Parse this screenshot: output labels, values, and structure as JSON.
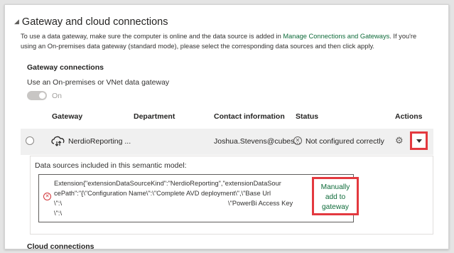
{
  "section": {
    "title": "Gateway and cloud connections",
    "description_part1": "To use a data gateway, make sure the computer is online and the data source is added in ",
    "manage_link": "Manage Connections and Gateways",
    "description_part2": ". If you're using an On-premises data gateway (standard mode), please select the corresponding data sources and then click apply."
  },
  "gateway_connections": {
    "title": "Gateway connections",
    "use_gateway_label": "Use an On-premises or VNet data gateway",
    "toggle_label": "On",
    "columns": {
      "gateway": "Gateway",
      "department": "Department",
      "contact": "Contact information",
      "status": "Status",
      "actions": "Actions"
    },
    "row": {
      "gateway_name": "NerdioReporting ...",
      "contact": "Joshua.Stevens@cubes...",
      "status": "Not configured correctly"
    }
  },
  "data_sources": {
    "label": "Data sources included in this semantic model:",
    "line1": "Extension{\"extensionDataSourceKind\":\"NerdioReporting\",\"extensionDataSour",
    "line2": "cePath\":\"{\\\"Configuration Name\\\":\\\"Complete AVD deployment\\\",\\\"Base Url",
    "line3a": "\\\":\\",
    "line3b": "\\\"PowerBi Access Key",
    "line4": "\\\":\\",
    "manual_button": "Manually add to gateway"
  },
  "cloud_connections": {
    "title": "Cloud connections"
  },
  "colors": {
    "highlight_box": "#e3393f",
    "link": "#0f6b3a",
    "error": "#d13438"
  },
  "icons": {
    "collapse": "triangle-caret",
    "gateway": "cloud-gateway-icon",
    "status": "x-circle-icon",
    "settings": "gear-icon",
    "expand": "chevron-down-icon",
    "error": "error-circle-icon"
  }
}
